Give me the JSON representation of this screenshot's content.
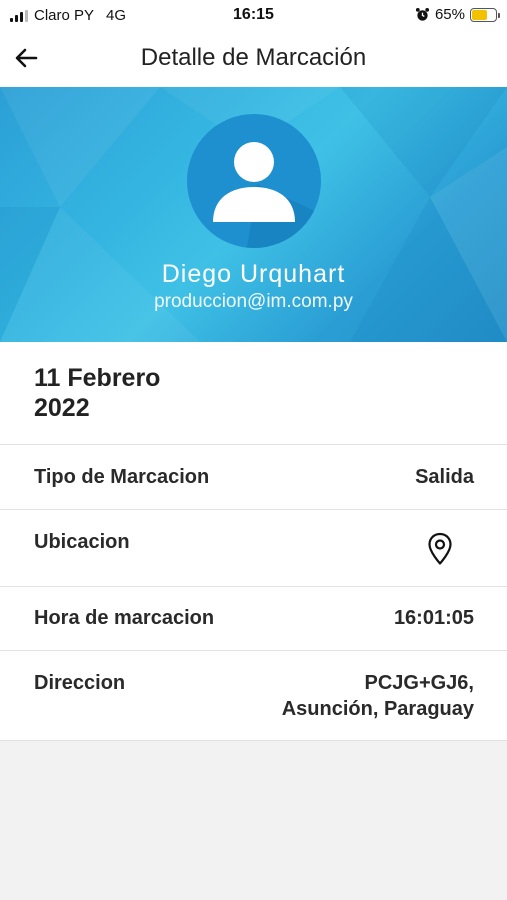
{
  "status_bar": {
    "carrier": "Claro PY",
    "network": "4G",
    "time": "16:15",
    "battery": "65%",
    "battery_level": 0.65,
    "icons": [
      "signal-icon",
      "alarm-icon",
      "battery-icon"
    ]
  },
  "header": {
    "title": "Detalle de Marcación",
    "back_icon": "arrow-left-icon"
  },
  "profile": {
    "name": "Diego Urquhart",
    "email": "produccion@im.com.py",
    "avatar_icon": "user-avatar-icon"
  },
  "date": {
    "line1": "11 Febrero",
    "line2": "2022"
  },
  "details": {
    "tipo_label": "Tipo de Marcacion",
    "tipo_value": "Salida",
    "ubicacion_label": "Ubicacion",
    "ubicacion_icon": "location-pin-icon",
    "hora_label": "Hora de marcacion",
    "hora_value": "16:01:05",
    "direccion_label": "Direccion",
    "direccion_line1": "PCJG+GJ6,",
    "direccion_line2": "Asunción, Paraguay"
  },
  "colors": {
    "hero_gradient_mid": "#3fc1e6",
    "avatar_bg": "#1e8fcf",
    "battery_fill": "#f2c200",
    "background_bottom": "#f2f2f2"
  }
}
